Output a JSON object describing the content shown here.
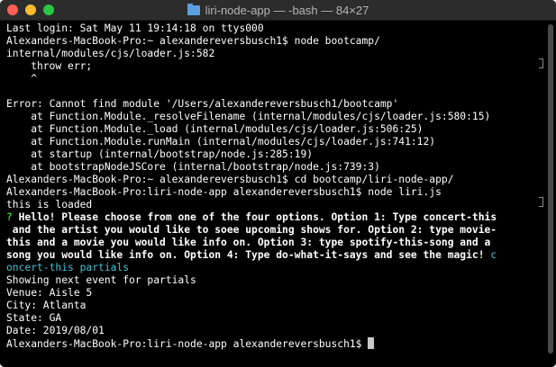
{
  "window": {
    "title": "liri-node-app — -bash — 84×27",
    "icon": "folder-icon"
  },
  "terminal": {
    "lines": [
      "Last login: Sat May 11 19:14:18 on ttys000",
      "Alexanders-MacBook-Pro:~ alexandereversbusch1$ node bootcamp/",
      "internal/modules/cjs/loader.js:582",
      "    throw err;",
      "    ^",
      "",
      "Error: Cannot find module '/Users/alexandereversbusch1/bootcamp'",
      "    at Function.Module._resolveFilename (internal/modules/cjs/loader.js:580:15)",
      "    at Function.Module._load (internal/modules/cjs/loader.js:506:25)",
      "    at Function.Module.runMain (internal/modules/cjs/loader.js:741:12)",
      "    at startup (internal/bootstrap/node.js:285:19)",
      "    at bootstrapNodeJSCore (internal/bootstrap/node.js:739:3)",
      "Alexanders-MacBook-Pro:~ alexandereversbusch1$ cd bootcamp/liri-node-app/",
      "Alexanders-MacBook-Pro:liri-node-app alexandereversbusch1$ node liri.js",
      "this is loaded"
    ],
    "prompt_mark": "?",
    "question_lines": [
      " Hello! Please choose from one of the four options. Option 1: Type concert-this",
      " and the artist you would like to soee upcoming shows for. Option 2: type movie-",
      "this and a movie you would like info on. Option 3: type spotify-this-song and a",
      "song you would like info on. Option 4: Type do-what-it-says and see the magic!"
    ],
    "answer_first": " c",
    "answer_rest": "oncert-this partials",
    "result_lines": [
      "Showing next event for partials",
      "Venue: Aisle 5",
      "City: Atlanta",
      "State: GA",
      "Date: 2019/08/01"
    ],
    "final_prompt": "Alexanders-MacBook-Pro:liri-node-app alexandereversbusch1$ "
  },
  "colors": {
    "background": "#000000",
    "text": "#ffffff",
    "prompt_mark": "#3fc93f",
    "answer": "#46c4d6"
  }
}
